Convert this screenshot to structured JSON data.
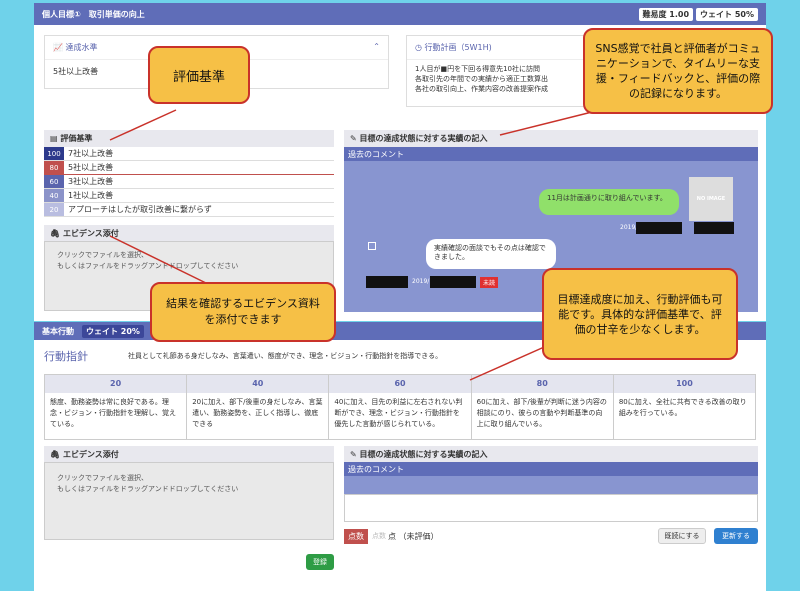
{
  "top": {
    "title": "個人目標①　取引単価の向上",
    "difficulty_label": "難易度",
    "difficulty_value": "1.00",
    "weight_label": "ウェイト",
    "weight_value": "50%"
  },
  "level": {
    "title": "達成水準",
    "text": "5社以上改善"
  },
  "plan": {
    "title": "行動計画（5W1H)",
    "lines": [
      "1人目が■円を下回る得意先10社に訪問",
      "各取引先の年間での実績から適正工数算出",
      "各社の取引向上、作業内容の改善提案作成"
    ]
  },
  "criteria": {
    "title": "評価基準",
    "items": [
      {
        "score": "100",
        "text": "7社以上改善",
        "color": "#2d3a8c"
      },
      {
        "score": "80",
        "text": "5社以上改善",
        "color": "#c0504d"
      },
      {
        "score": "60",
        "text": "3社以上改善",
        "color": "#5a64ad"
      },
      {
        "score": "40",
        "text": "1社以上改善",
        "color": "#8b93c9"
      },
      {
        "score": "20",
        "text": "アプローチはしたが取引改善に繋がらず",
        "color": "#b9bde0"
      }
    ]
  },
  "evidence1": {
    "title": "エビデンス添付",
    "line1": "クリックでファイルを選択、",
    "line2": "もしくはファイルをドラッグアンドドロップしてください"
  },
  "record1": {
    "title": "目標の達成状態に対する実績の記入",
    "past": "過去のコメント",
    "msg1": "11月は計画通りに取り組んでいます。",
    "noimage": "NO IMAGE",
    "date1": "2019/",
    "msg2": "実績確認の面談でもその点は確認できました。",
    "date2": "2019/",
    "unread": "未読"
  },
  "basic": {
    "title": "基本行動",
    "weight_label": "ウェイト",
    "weight_value": "20%",
    "guideline_label": "行動指針",
    "guideline_text": "社員として礼節ある身だしなみ、言葉遣い、態度ができ、理念・ビジョン・行動指針を指導できる。",
    "levels": [
      "20",
      "40",
      "60",
      "80",
      "100"
    ],
    "descs": [
      "態度、勤務姿勢は常に良好である。理念・ビジョン・行動指針を理解し、覚えている。",
      "20に加え、部下/後輩の身だしなみ、言葉遣い、勤務姿勢を、正しく指導し、徹底できる",
      "40に加え、目先の利益に左右されない判断ができ、理念・ビジョン・行動指針を優先した言動が感じられている。",
      "60に加え、部下/後輩が判断に迷う内容の相談にのり、彼らの言動や判断基準の向上に取り組んでいる。",
      "80に加え、全社に共有できる改善の取り組みを行っている。"
    ]
  },
  "evidence2": {
    "title": "エビデンス添付",
    "line1": "クリックでファイルを選択、",
    "line2": "もしくはファイルをドラッグアンドドロップしてください",
    "register": "登録"
  },
  "record2": {
    "title": "目標の達成状態に対する実績の記入",
    "past": "過去のコメント",
    "score_label": "点数",
    "score_placeholder": "点数",
    "score_unit": "点 （未評価）",
    "reject": "既読にする",
    "update": "更新する"
  },
  "callouts": {
    "c1": "評価基準",
    "c2": "SNS感覚で社員と評価者がコミュニケーションで、タイムリーな支援・フィードバックと、評価の際の記録になります。",
    "c3": "結果を確認するエビデンス資料を添付できます",
    "c4": "目標達成度に加え、行動評価も可能です。具体的な評価基準で、評価の甘辛を少なくします。"
  }
}
